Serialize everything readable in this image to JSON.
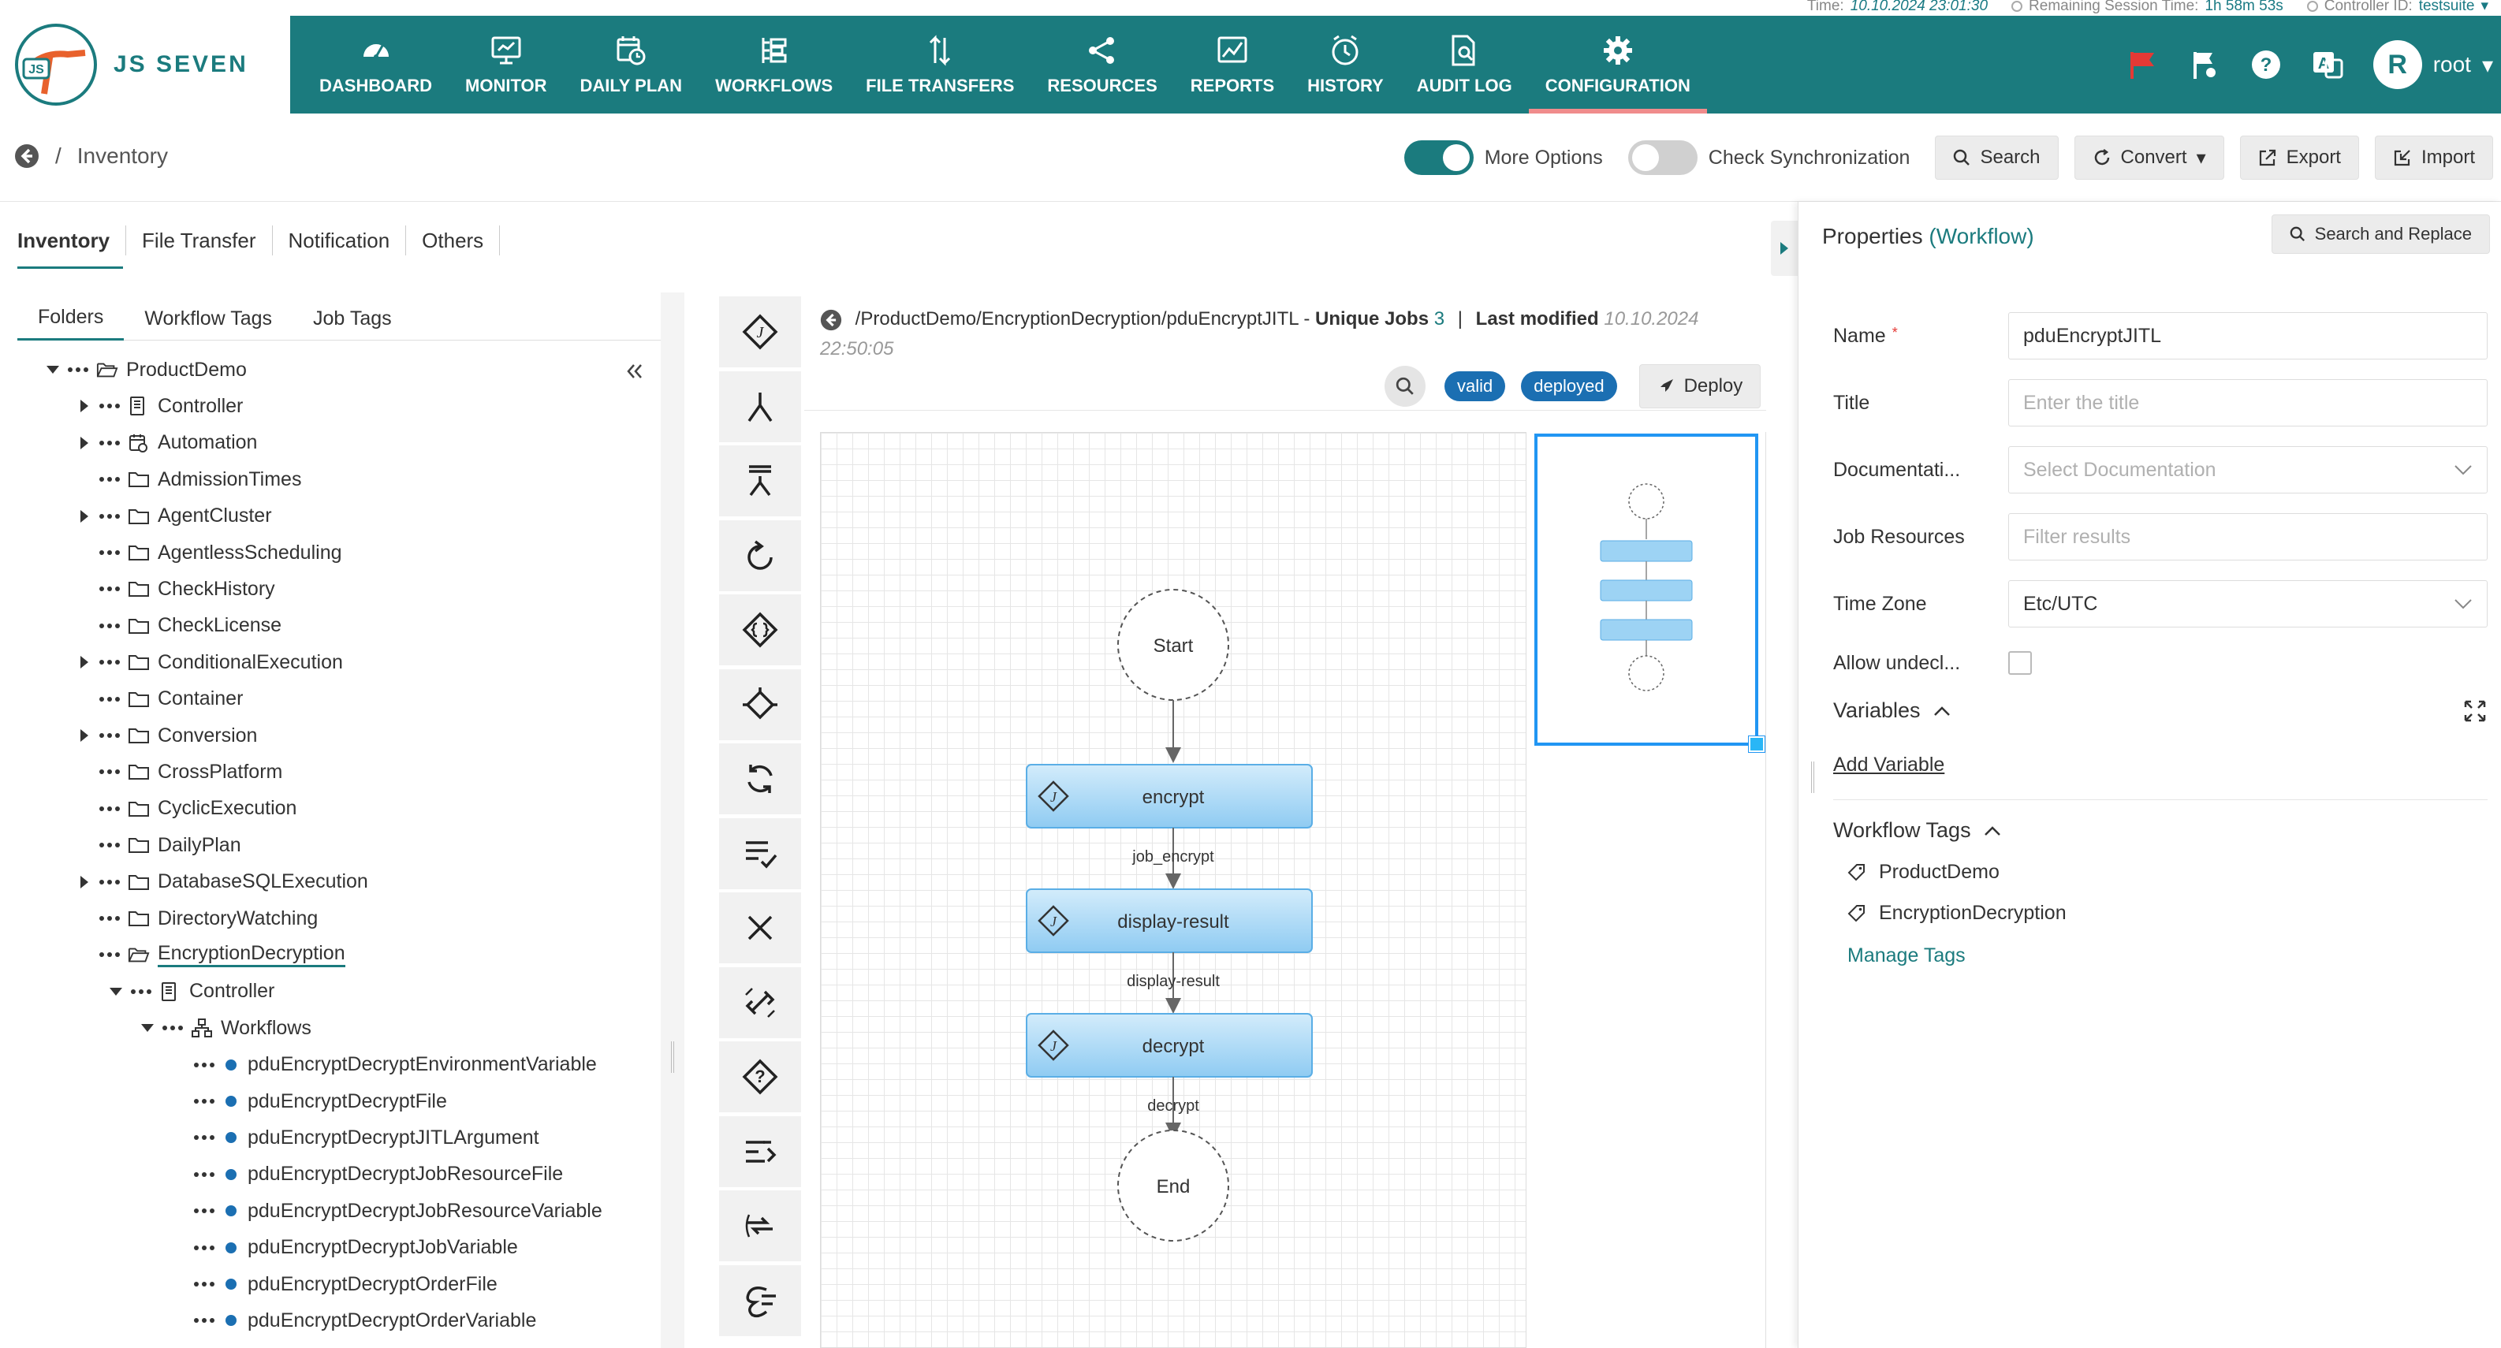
{
  "topbar": {
    "time_label": "Time:",
    "time_value": "10.10.2024 23:01:30",
    "session_label": "Remaining Session Time:",
    "session_value": "1h 58m 53s",
    "controller_label": "Controller ID:",
    "controller_value": "testsuite"
  },
  "logo": {
    "text": "JS SEVEN",
    "mark": "JS7"
  },
  "nav": [
    {
      "label": "DASHBOARD",
      "icon": "dashboard-icon"
    },
    {
      "label": "MONITOR",
      "icon": "monitor-icon"
    },
    {
      "label": "DAILY PLAN",
      "icon": "calendar-clock-icon"
    },
    {
      "label": "WORKFLOWS",
      "icon": "workflow-icon"
    },
    {
      "label": "FILE TRANSFERS",
      "icon": "file-transfer-icon"
    },
    {
      "label": "RESOURCES",
      "icon": "share-icon"
    },
    {
      "label": "REPORTS",
      "icon": "chart-icon"
    },
    {
      "label": "HISTORY",
      "icon": "clock-icon"
    },
    {
      "label": "AUDIT LOG",
      "icon": "audit-icon"
    },
    {
      "label": "CONFIGURATION",
      "icon": "gear-icon",
      "active": true
    }
  ],
  "user": {
    "initial": "R",
    "name": "root"
  },
  "breadcrumb": {
    "page": "Inventory",
    "separator": "/"
  },
  "actions": {
    "more_options": "More Options",
    "check_sync": "Check Synchronization",
    "search": "Search",
    "convert": "Convert",
    "export": "Export",
    "import": "Import"
  },
  "left_tabs": [
    "Inventory",
    "File Transfer",
    "Notification",
    "Others"
  ],
  "sub_tabs": [
    "Folders",
    "Workflow Tags",
    "Job Tags"
  ],
  "tree": [
    {
      "label": "ProductDemo",
      "level": 0,
      "expand": "open",
      "icon": "folder-open"
    },
    {
      "label": "Controller",
      "level": 1,
      "expand": "closed",
      "icon": "controller"
    },
    {
      "label": "Automation",
      "level": 1,
      "expand": "closed",
      "icon": "automation"
    },
    {
      "label": "AdmissionTimes",
      "level": 1,
      "expand": "none",
      "icon": "folder"
    },
    {
      "label": "AgentCluster",
      "level": 1,
      "expand": "closed",
      "icon": "folder"
    },
    {
      "label": "AgentlessScheduling",
      "level": 1,
      "expand": "none",
      "icon": "folder"
    },
    {
      "label": "CheckHistory",
      "level": 1,
      "expand": "none",
      "icon": "folder"
    },
    {
      "label": "CheckLicense",
      "level": 1,
      "expand": "none",
      "icon": "folder"
    },
    {
      "label": "ConditionalExecution",
      "level": 1,
      "expand": "closed",
      "icon": "folder"
    },
    {
      "label": "Container",
      "level": 1,
      "expand": "none",
      "icon": "folder"
    },
    {
      "label": "Conversion",
      "level": 1,
      "expand": "closed",
      "icon": "folder"
    },
    {
      "label": "CrossPlatform",
      "level": 1,
      "expand": "none",
      "icon": "folder"
    },
    {
      "label": "CyclicExecution",
      "level": 1,
      "expand": "none",
      "icon": "folder"
    },
    {
      "label": "DailyPlan",
      "level": 1,
      "expand": "none",
      "icon": "folder"
    },
    {
      "label": "DatabaseSQLExecution",
      "level": 1,
      "expand": "closed",
      "icon": "folder"
    },
    {
      "label": "DirectoryWatching",
      "level": 1,
      "expand": "none",
      "icon": "folder"
    },
    {
      "label": "EncryptionDecryption",
      "level": 1,
      "expand": "none",
      "icon": "folder-open",
      "selected": true
    },
    {
      "label": "Controller",
      "level": 2,
      "expand": "open",
      "icon": "controller"
    },
    {
      "label": "Workflows",
      "level": 3,
      "expand": "open",
      "icon": "workflows"
    },
    {
      "label": "pduEncryptDecryptEnvironmentVariable",
      "level": 4,
      "expand": "none",
      "icon": "dot"
    },
    {
      "label": "pduEncryptDecryptFile",
      "level": 4,
      "expand": "none",
      "icon": "dot"
    },
    {
      "label": "pduEncryptDecryptJITLArgument",
      "level": 4,
      "expand": "none",
      "icon": "dot"
    },
    {
      "label": "pduEncryptDecryptJobResourceFile",
      "level": 4,
      "expand": "none",
      "icon": "dot"
    },
    {
      "label": "pduEncryptDecryptJobResourceVariable",
      "level": 4,
      "expand": "none",
      "icon": "dot"
    },
    {
      "label": "pduEncryptDecryptJobVariable",
      "level": 4,
      "expand": "none",
      "icon": "dot"
    },
    {
      "label": "pduEncryptDecryptOrderFile",
      "level": 4,
      "expand": "none",
      "icon": "dot"
    },
    {
      "label": "pduEncryptDecryptOrderVariable",
      "level": 4,
      "expand": "none",
      "icon": "dot"
    }
  ],
  "toolbar_icons": [
    "job-icon",
    "fork-icon",
    "fork-list-icon",
    "retry-icon",
    "lock-icon",
    "if-icon",
    "cycle-icon",
    "prompt-icon",
    "fail-icon",
    "finish-icon",
    "post-notice-icon",
    "expect-notice-icon",
    "add-order-icon",
    "sticky-icon"
  ],
  "workflow": {
    "path": "/ProductDemo/EncryptionDecryption/pduEncryptJITL",
    "unique_jobs_label": "Unique Jobs",
    "unique_jobs_count": "3",
    "last_modified_label": "Last modified",
    "last_modified_date": "10.10.2024",
    "last_modified_time": "22:50:05",
    "badges": [
      "valid",
      "deployed"
    ],
    "deploy": "Deploy",
    "nodes": {
      "start": "Start",
      "end": "End",
      "jobs": [
        {
          "label": "encrypt",
          "edge": "job_encrypt"
        },
        {
          "label": "display-result",
          "edge": "display-result"
        },
        {
          "label": "decrypt",
          "edge": "decrypt"
        }
      ]
    }
  },
  "properties": {
    "title": "Properties",
    "type": "(Workflow)",
    "search_replace": "Search and Replace",
    "fields": [
      {
        "label": "Name",
        "value": "pduEncryptJITL",
        "required": true,
        "type": "text"
      },
      {
        "label": "Title",
        "placeholder": "Enter the title",
        "type": "text"
      },
      {
        "label": "Documentati...",
        "placeholder": "Select Documentation",
        "type": "select"
      },
      {
        "label": "Job Resources",
        "placeholder": "Filter results",
        "type": "text"
      },
      {
        "label": "Time Zone",
        "value": "Etc/UTC",
        "type": "select"
      },
      {
        "label": "Allow undecl...",
        "type": "checkbox"
      }
    ],
    "variables_label": "Variables",
    "add_variable": "Add Variable",
    "workflow_tags_label": "Workflow Tags",
    "tags": [
      "ProductDemo",
      "EncryptionDecryption"
    ],
    "manage_tags": "Manage Tags"
  },
  "colors": {
    "primary": "#1b7b7e",
    "accent_link": "#1b7b7e",
    "job_blue": "#a9d8f7",
    "badge_blue": "#1b6fb2",
    "flag_red": "#e53935"
  }
}
